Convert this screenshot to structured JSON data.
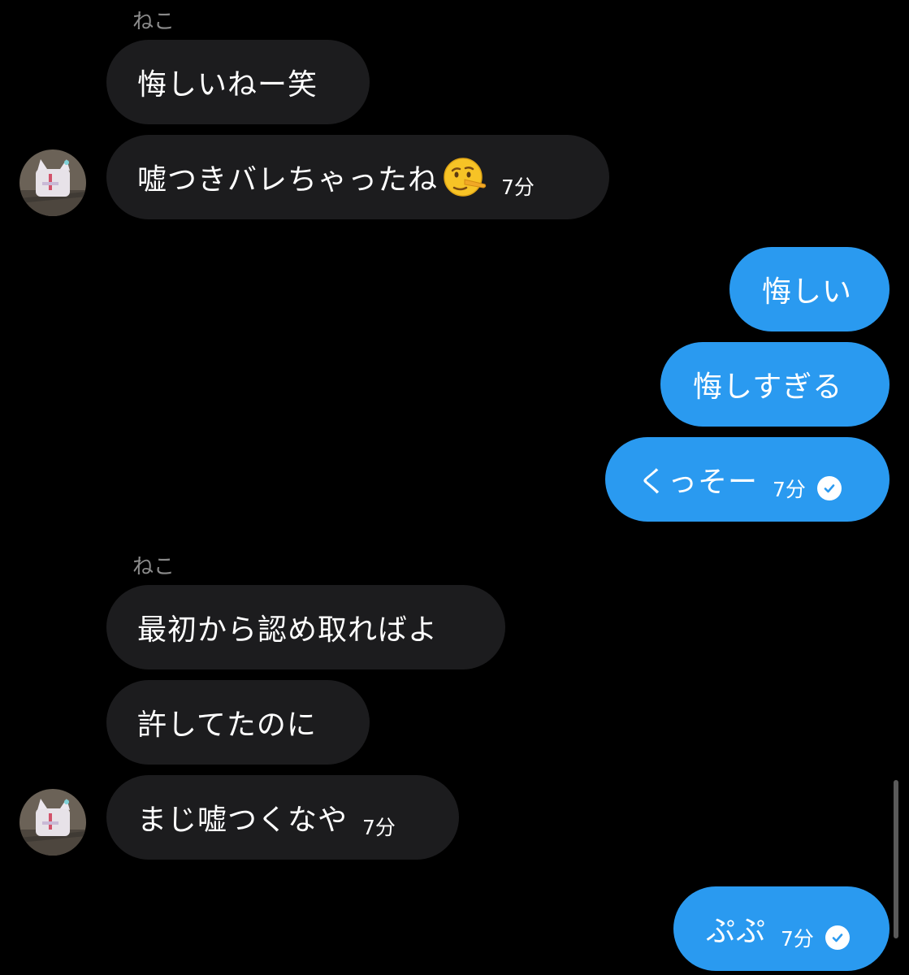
{
  "colors": {
    "background": "#000000",
    "incoming_bubble": "#1c1c1e",
    "outgoing_bubble": "#2a9af0",
    "sender_name": "#8b8b8b"
  },
  "messages": [
    {
      "sender": "ねこ",
      "text": "悔しいねー笑"
    },
    {
      "text": "嘘つきバレちゃったね",
      "emoji": "lying-face-icon",
      "time": "7分"
    },
    {
      "text": "悔しい"
    },
    {
      "text": "悔しすぎる"
    },
    {
      "text": "くっそー",
      "time": "7分",
      "status_icon": "read-check-icon"
    },
    {
      "sender": "ねこ",
      "text": "最初から認め取ればよ"
    },
    {
      "text": "許してたのに"
    },
    {
      "text": "まじ嘘つくなや",
      "time": "7分"
    },
    {
      "text": "ぷぷ",
      "time": "7分",
      "status_icon": "read-check-icon"
    }
  ]
}
